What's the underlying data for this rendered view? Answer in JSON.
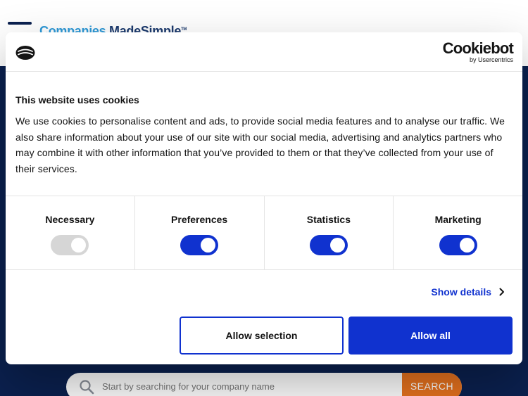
{
  "site": {
    "logo": {
      "part1": "Companies ",
      "part2": "MadeSimple",
      "tm": "TM"
    },
    "search": {
      "placeholder": "Start by searching for your company name",
      "button_label": "SEARCH"
    }
  },
  "cookie_dialog": {
    "brand": {
      "name": "Cookiebot",
      "subtitle": "by Usercentrics"
    },
    "title": "This website uses cookies",
    "body": "We use cookies to personalise content and ads, to provide social media features and to analyse our traffic. We also share information about your use of our site with our social media, advertising and analytics partners who may combine it with other information that you’ve provided to them or that they’ve collected from your use of their services.",
    "categories": [
      {
        "label": "Necessary",
        "enabled": true,
        "disabled": true
      },
      {
        "label": "Preferences",
        "enabled": true,
        "disabled": false
      },
      {
        "label": "Statistics",
        "enabled": true,
        "disabled": false
      },
      {
        "label": "Marketing",
        "enabled": true,
        "disabled": false
      }
    ],
    "show_details_label": "Show details",
    "allow_selection_label": "Allow selection",
    "allow_all_label": "Allow all"
  },
  "colors": {
    "accent": "#1032cf",
    "site_background": "#0b2150",
    "search_button": "#e8731f"
  },
  "icons": {
    "brand": "cookie-icon",
    "show_details": "chevron-right-icon",
    "search": "search-icon",
    "menu": "hamburger-icon"
  }
}
